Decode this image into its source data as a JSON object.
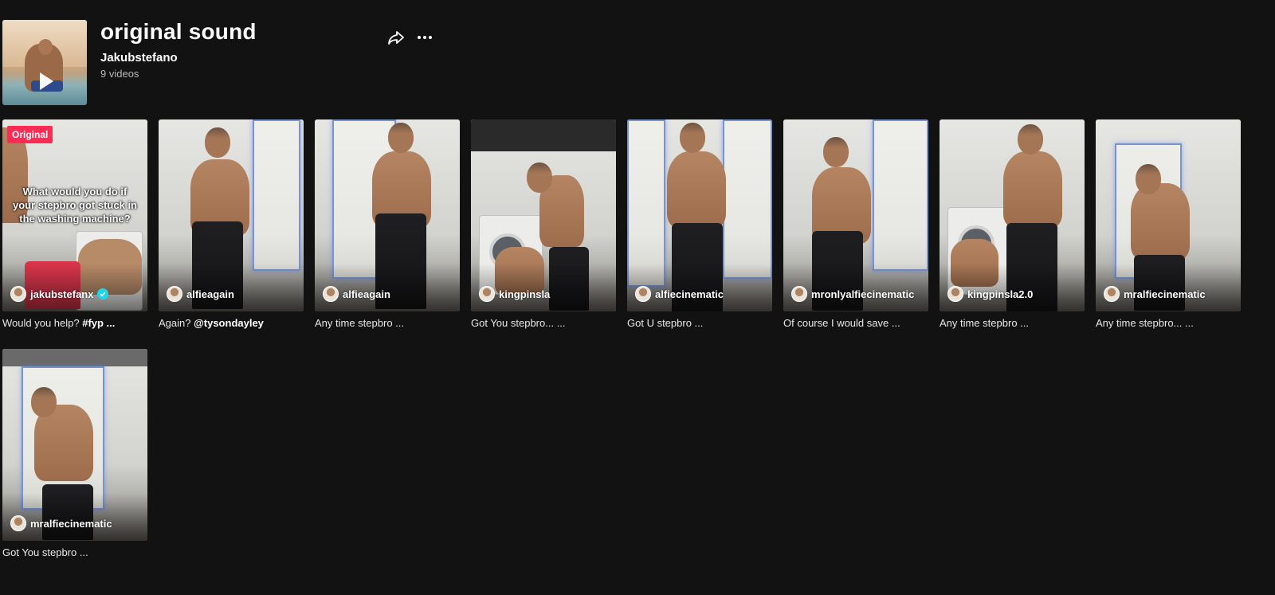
{
  "sound": {
    "title": "original sound",
    "author": "Jakubstefano",
    "video_count": "9 videos"
  },
  "icons": {
    "play": "play-icon",
    "share": "share-icon",
    "more": "more-horizontal-icon",
    "verified": "verified-check-icon"
  },
  "colors": {
    "background": "#121212",
    "original_badge": "#fe2c55",
    "verified": "#20d5ec"
  },
  "videos": [
    {
      "badge": "Original",
      "overlay": "What would you do if your stepbro  got stuck in the washing machine?",
      "creator": "jakubstefanx",
      "verified": true,
      "caption": "Would you help? ",
      "caption_tag": "#fyp ..."
    },
    {
      "creator": "alfieagain",
      "caption": "Again? ",
      "caption_tag": "@tysondayley"
    },
    {
      "creator": "alfieagain",
      "caption": "Any time stepbro ..."
    },
    {
      "creator": "kingpinsla",
      "caption": "Got You stepbro... ..."
    },
    {
      "creator": "alfiecinematic",
      "caption": "Got U stepbro ..."
    },
    {
      "creator": "mronlyalfiecinematic",
      "caption": "Of course I would save ..."
    },
    {
      "creator": "kingpinsla2.0",
      "caption": "Any time stepbro ..."
    },
    {
      "creator": "mralfiecinematic",
      "caption": "Any time stepbro... ..."
    },
    {
      "creator": "mralfiecinematic",
      "caption": "Got You stepbro ..."
    }
  ]
}
